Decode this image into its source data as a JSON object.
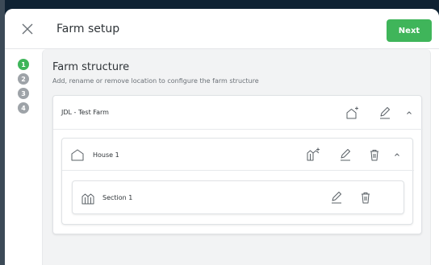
{
  "header": {
    "title": "Farm setup",
    "next_label": "Next"
  },
  "stepper": {
    "steps": [
      "1",
      "2",
      "3",
      "4"
    ],
    "current": "1"
  },
  "structure": {
    "title": "Farm structure",
    "subtitle": "Add, rename or remove location to configure the farm structure",
    "farm": {
      "name": "JDL - Test Farm",
      "house": {
        "name": "House 1",
        "section": {
          "name": "Section 1"
        }
      }
    }
  },
  "colors": {
    "accent": "#3fb55a",
    "step_inactive": "#9ea3a8",
    "panel_bg": "#f2f3f4"
  },
  "icons": {
    "close": "close-icon",
    "add_house": "add-house-icon",
    "add_section": "add-section-icon",
    "edit": "pencil-icon",
    "delete": "trash-icon",
    "collapse": "chevron-up-icon",
    "house": "house-icon",
    "section": "section-icon"
  }
}
